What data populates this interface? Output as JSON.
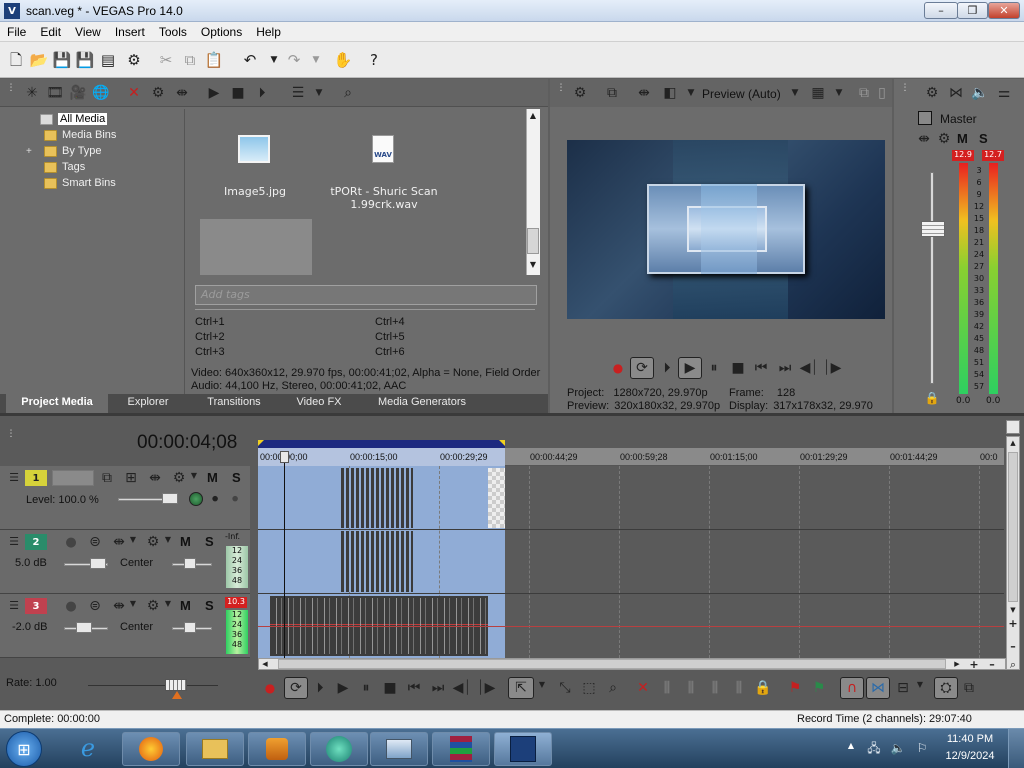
{
  "window": {
    "title": "scan.veg * - VEGAS Pro 14.0",
    "logo": "V",
    "btn_min": "–",
    "btn_max": "❐",
    "btn_close": "✕"
  },
  "menu": [
    "File",
    "Edit",
    "View",
    "Insert",
    "Tools",
    "Options",
    "Help"
  ],
  "project_media": {
    "tree": [
      "All Media",
      "Media Bins",
      "By Type",
      "Tags",
      "Smart Bins"
    ],
    "expander": "+",
    "files": [
      {
        "name": "Image5.jpg"
      },
      {
        "name": "tPORt - Shuric Scan 1.99crk.wav"
      }
    ],
    "wav_badge": "WAV",
    "tags_placeholder": "Add tags",
    "shortcuts": [
      "Ctrl+1",
      "Ctrl+4",
      "Ctrl+2",
      "Ctrl+5",
      "Ctrl+3",
      "Ctrl+6"
    ],
    "info_video": "Video: 640x360x12, 29.970 fps, 00:00:41;02, Alpha = None, Field Order",
    "info_audio": "Audio: 44,100 Hz, Stereo, 00:00:41;02, AAC",
    "tabs": [
      "Project Media",
      "Explorer",
      "Transitions",
      "Video FX",
      "Media Generators"
    ]
  },
  "preview": {
    "mode_label": "Preview (Auto)",
    "project_label": "Project:",
    "project_value": "1280x720, 29.970p",
    "preview_label": "Preview:",
    "preview_value": "320x180x32, 29.970p",
    "frame_label": "Frame:",
    "frame_value": "128",
    "display_label": "Display:",
    "display_value": "317x178x32, 29.970"
  },
  "master": {
    "label": "Master",
    "peak_left": "12.9",
    "peak_right": "12.7",
    "scale": [
      "3",
      "6",
      "9",
      "12",
      "15",
      "18",
      "21",
      "24",
      "27",
      "30",
      "33",
      "36",
      "39",
      "42",
      "45",
      "48",
      "51",
      "54",
      "57"
    ],
    "bottom_left": "0.0",
    "bottom_right": "0.0",
    "m": "M",
    "s": "S",
    "level_fraction": 0.73
  },
  "timeline": {
    "timecode": "00:00:04;08",
    "ruler": [
      "00:00:00;00",
      "00:00:15;00",
      "00:00:29;29",
      "00:00:44;29",
      "00:00:59;28",
      "00:01:15;00",
      "00:01:29;29",
      "00:01:44;29",
      "00:0"
    ],
    "tracks": [
      {
        "num": "1",
        "label": "Level: 100.0 %",
        "m": "M",
        "s": "S"
      },
      {
        "num": "2",
        "label": "5.0 dB",
        "pan": "Center",
        "m": "M",
        "s": "S",
        "meter_top": "-Inf.",
        "meter_marks": [
          "12",
          "24",
          "36",
          "48"
        ]
      },
      {
        "num": "3",
        "label": "-2.0 dB",
        "pan": "Center",
        "m": "M",
        "s": "S",
        "meter_top": "10.3",
        "meter_marks": [
          "12",
          "24",
          "36",
          "48"
        ]
      }
    ],
    "rate": "Rate: 1.00",
    "record_time": "Record Time (2 channels): 29:07:40",
    "status": "Complete: 00:00:00",
    "side_buttons": [
      "+",
      "–",
      "+",
      "–"
    ]
  },
  "taskbar": {
    "time": "11:40 PM",
    "date": "12/9/2024",
    "start": "⊞"
  },
  "colors": {
    "track1": "#d6d23a",
    "track2": "#2a8c6a",
    "track3": "#c0414f",
    "selection": "#90acd6",
    "accent": "#1d2a80"
  }
}
